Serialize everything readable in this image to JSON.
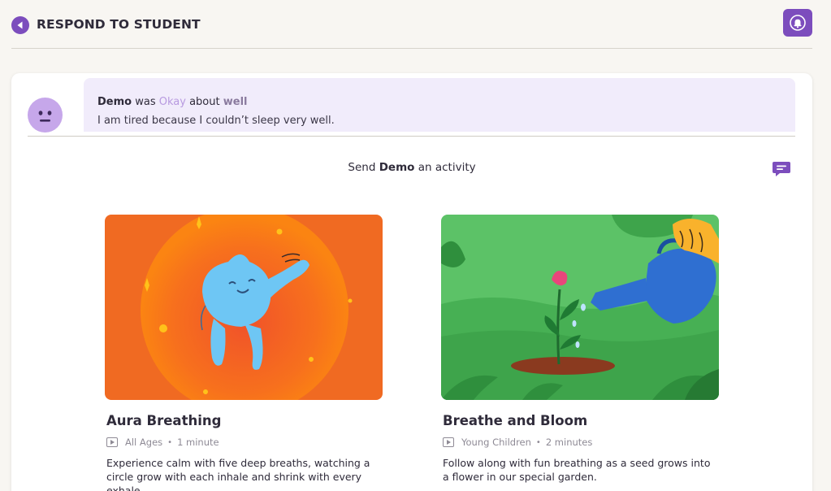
{
  "header": {
    "title": "RESPOND TO STUDENT",
    "back_icon": "back-arrow-circle-icon",
    "bell_icon": "bell-icon"
  },
  "colors": {
    "brand_purple": "#7c4dbd",
    "avatar": "#c6a7ea",
    "checkin_bg": "#f1ecfb",
    "mood": "#b89ae0"
  },
  "checkin": {
    "student": "Demo",
    "was": "was",
    "mood": "Okay",
    "about": "about",
    "topic": "well",
    "message": "I am tired because I couldn’t sleep very well.",
    "avatar_icon": "neutral-face-icon"
  },
  "send": {
    "prefix": "Send",
    "student": "Demo",
    "suffix": "an activity",
    "chat_icon": "chat-message-icon"
  },
  "activities": [
    {
      "title": "Aura Breathing",
      "audience": "All Ages",
      "duration": "1 minute",
      "description": "Experience calm with five deep breaths, watching a circle grow with each inhale and shrink with every exhale."
    },
    {
      "title": "Breathe and Bloom",
      "audience": "Young Children",
      "duration": "2 minutes",
      "description": "Follow along with fun breathing as a seed grows into a flower in our special garden."
    }
  ]
}
